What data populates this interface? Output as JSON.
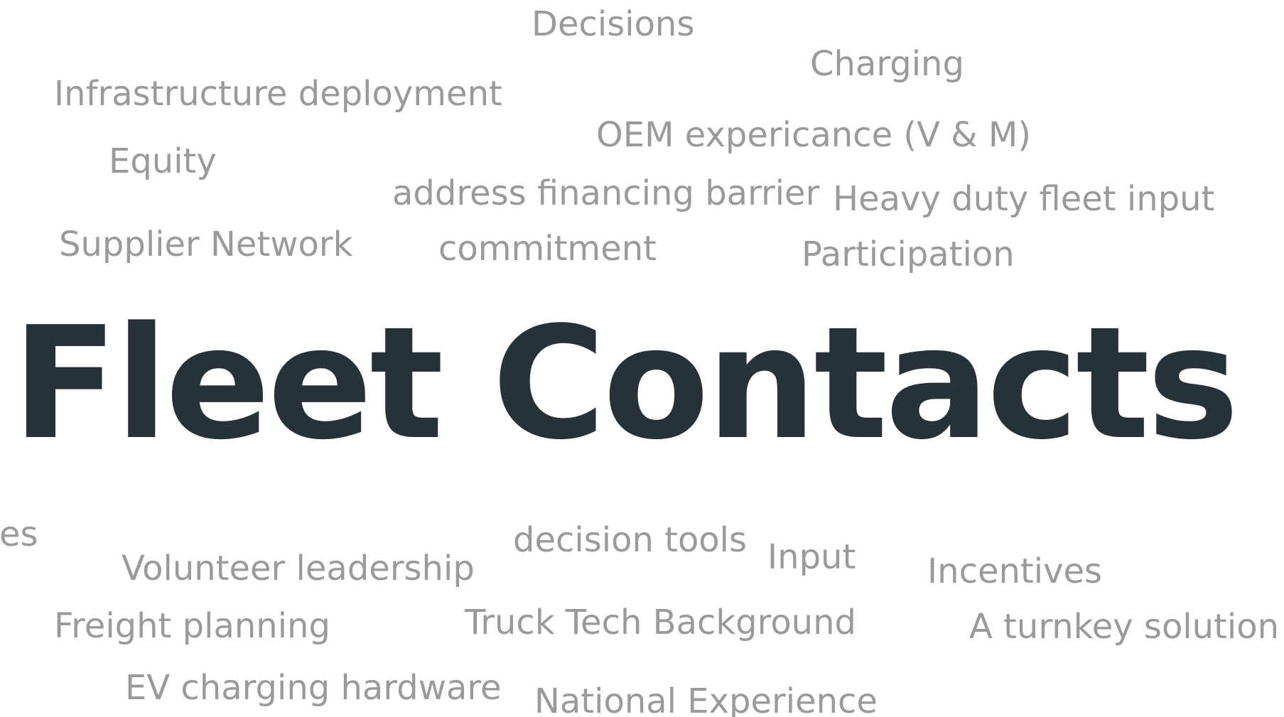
{
  "title": "Fleet Contacts",
  "colors": {
    "title": "#263238",
    "words": "#9a9a9a",
    "background": "#ffffff"
  },
  "words": {
    "decisions": "Decisions",
    "charging": "Charging",
    "infrastructure": "Infrastructure deployment",
    "oem": "OEM expericance (V & M)",
    "equity": "Equity",
    "financing": "address financing barrier",
    "heavy": "Heavy duty fleet input",
    "supplier": "Supplier Network",
    "commitment": "commitment",
    "participation": "Participation",
    "practices": "ctices",
    "decision_tools": "decision tools",
    "input": "Input",
    "volunteer": "Volunteer leadership",
    "incentives": "Incentives",
    "truck": "Truck Tech Background",
    "freight": "Freight planning",
    "turnkey": "A turnkey solution",
    "ev": "EV charging hardware",
    "national": "National Experience"
  }
}
